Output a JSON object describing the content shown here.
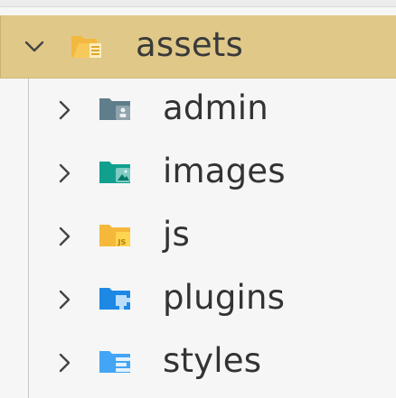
{
  "tree": {
    "root": {
      "label": "assets",
      "icon": "folder-open-assets-icon",
      "expanded": true,
      "color": "#f3b83e"
    },
    "children": [
      {
        "label": "admin",
        "icon": "folder-admin-icon",
        "color": "#607d8b"
      },
      {
        "label": "images",
        "icon": "folder-images-icon",
        "color": "#12a08e"
      },
      {
        "label": "js",
        "icon": "folder-js-icon",
        "color": "#f5b83a"
      },
      {
        "label": "plugins",
        "icon": "folder-plugins-icon",
        "color": "#1e88e5"
      },
      {
        "label": "styles",
        "icon": "folder-styles-icon",
        "color": "#42a5f5"
      }
    ]
  },
  "colors": {
    "selected_row": "#e0c889",
    "text": "#333333",
    "background": "#f6f6f6"
  }
}
